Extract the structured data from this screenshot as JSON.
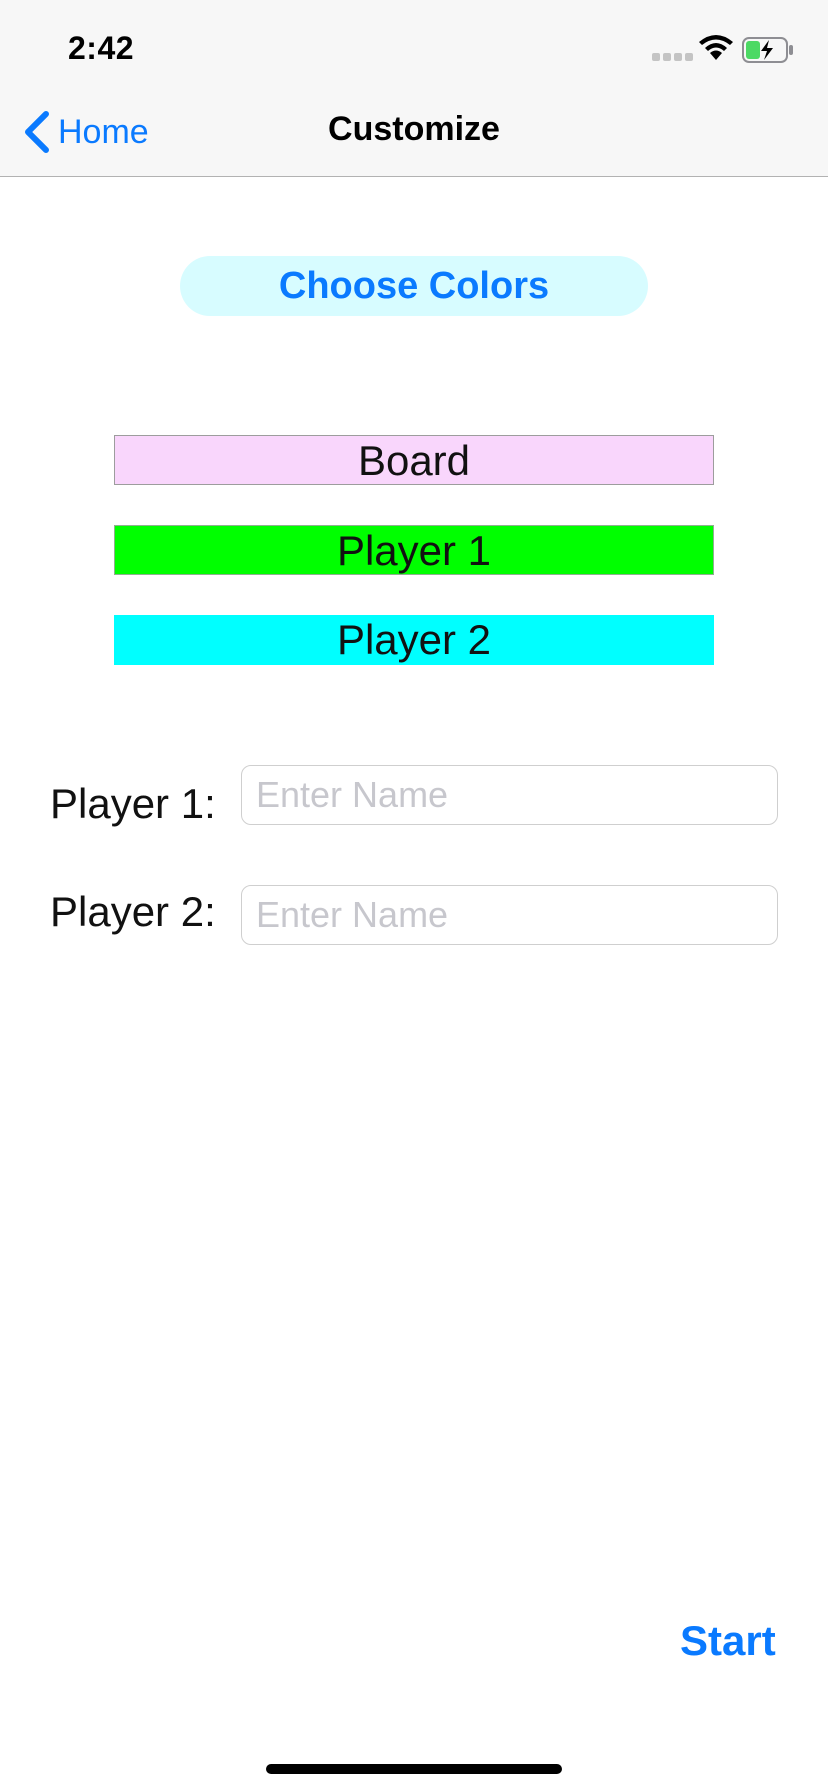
{
  "status_bar": {
    "time": "2:42",
    "signal_icon": "cellular-signal-icon",
    "wifi_icon": "wifi-icon",
    "battery_icon": "battery-charging-icon",
    "battery_color": "#4cd964"
  },
  "nav": {
    "back_label": "Home",
    "back_icon": "chevron-left-icon",
    "title": "Customize"
  },
  "choose_colors": {
    "label": "Choose Colors",
    "bg_color": "#d7fcff"
  },
  "color_swatches": [
    {
      "label": "Board",
      "color": "#f9d6fc"
    },
    {
      "label": "Player 1",
      "color": "#00ff00"
    },
    {
      "label": "Player 2",
      "color": "#00ffff"
    }
  ],
  "players": [
    {
      "label": "Player 1:",
      "value": "",
      "placeholder": "Enter Name"
    },
    {
      "label": "Player 2:",
      "value": "",
      "placeholder": "Enter Name"
    }
  ],
  "start_label": "Start",
  "accent_color": "#0a7aff"
}
